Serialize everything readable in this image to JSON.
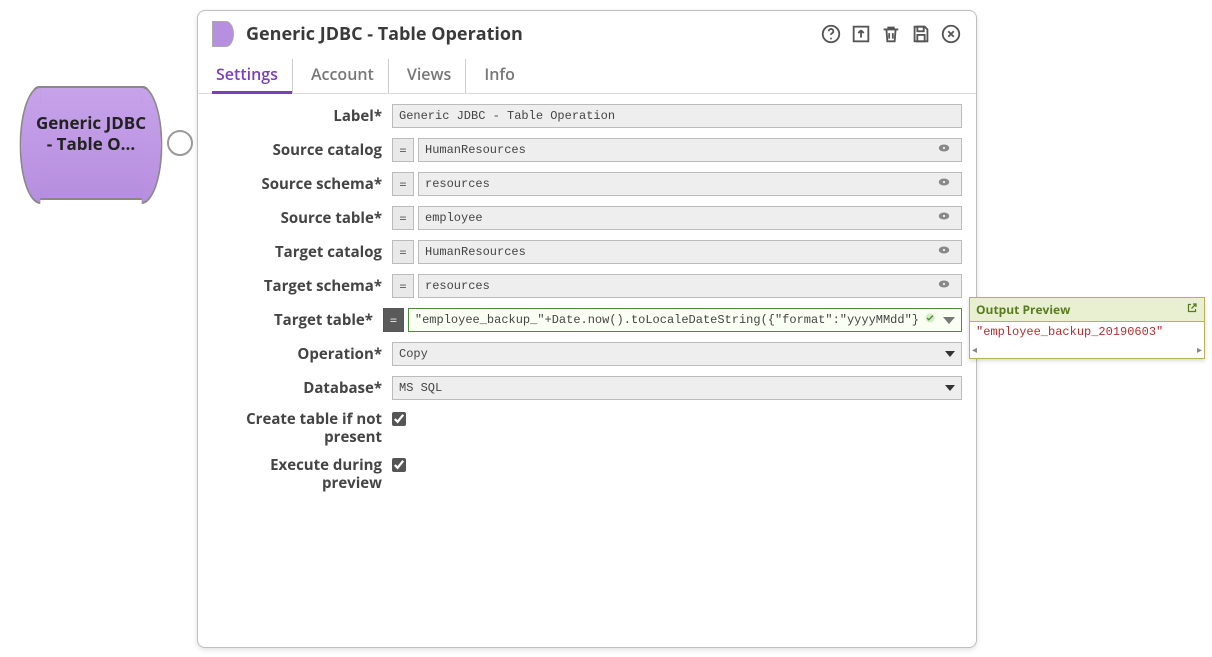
{
  "node": {
    "label_line1": "Generic JDBC",
    "label_line2": "- Table O..."
  },
  "dialog": {
    "title": "Generic JDBC - Table Operation",
    "tabs": [
      "Settings",
      "Account",
      "Views",
      "Info"
    ],
    "active_tab": "Settings"
  },
  "fields": {
    "label_lbl": "Label*",
    "label_val": "Generic JDBC - Table Operation",
    "source_catalog_lbl": "Source catalog",
    "source_catalog_val": "HumanResources",
    "source_schema_lbl": "Source schema*",
    "source_schema_val": "resources",
    "source_table_lbl": "Source table*",
    "source_table_val": "employee",
    "target_catalog_lbl": "Target catalog",
    "target_catalog_val": "HumanResources",
    "target_schema_lbl": "Target schema*",
    "target_schema_val": "resources",
    "target_table_lbl": "Target table*",
    "target_table_val": "\"employee_backup_\"+Date.now().toLocaleDateString({\"format\":\"yyyyMMdd\"}",
    "operation_lbl": "Operation*",
    "operation_val": "Copy",
    "database_lbl": "Database*",
    "database_val": "MS SQL",
    "create_lbl_l1": "Create table if not",
    "create_lbl_l2": "present",
    "exec_lbl_l1": "Execute during",
    "exec_lbl_l2": "preview",
    "create_checked": true,
    "exec_checked": true,
    "eq": "="
  },
  "preview": {
    "title": "Output Preview",
    "value": "\"employee_backup_20190603\""
  }
}
